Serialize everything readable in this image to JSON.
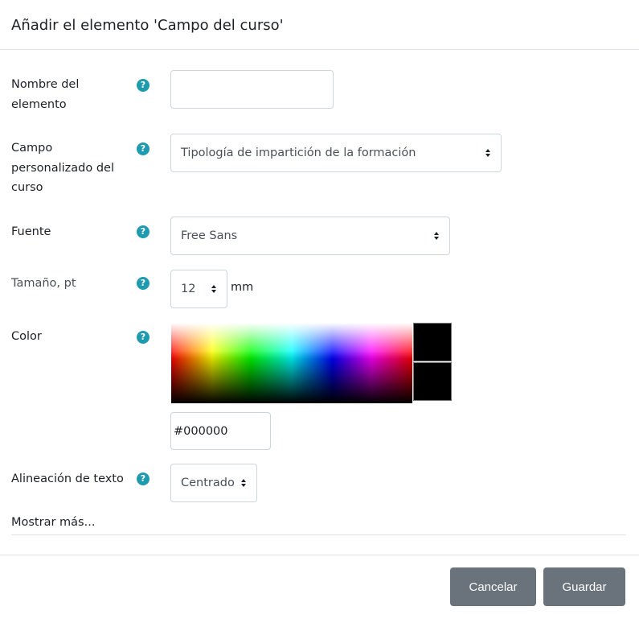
{
  "header": {
    "title": "Añadir el elemento 'Campo del curso'"
  },
  "form": {
    "element_name": {
      "label_line1": "Nombre del",
      "label_line2": "elemento",
      "value": ""
    },
    "course_field": {
      "label_line1": "Campo",
      "label_line2": "personalizado del",
      "label_line3": "curso",
      "selected": "Tipología de impartición de la formación"
    },
    "font": {
      "label": "Fuente",
      "selected": "Free Sans"
    },
    "size": {
      "label": "Tamaño, pt",
      "selected": "12",
      "unit": "mm"
    },
    "color": {
      "label": "Color",
      "value": "#000000",
      "current_swatch": "#000000",
      "preview_swatch": "#000000"
    },
    "alignment": {
      "label": "Alineación de texto",
      "selected": "Centrado"
    },
    "show_more": "Mostrar más..."
  },
  "footer": {
    "cancel_label": "Cancelar",
    "save_label": "Guardar"
  },
  "icons": {
    "help": "question-circle-icon",
    "select_arrow": "sort-arrows-icon"
  }
}
